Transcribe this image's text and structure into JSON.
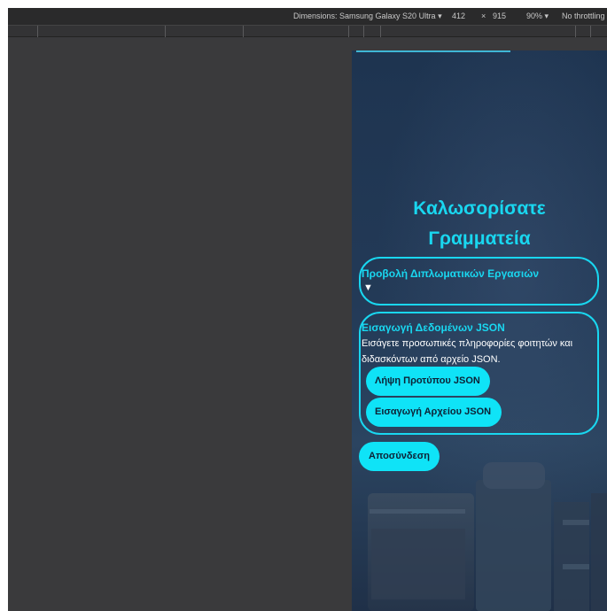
{
  "devtools": {
    "dimensions_label": "Dimensions: Samsung Galaxy S20 Ultra ▾",
    "width": "412",
    "times": "×",
    "height": "915",
    "zoom": "90% ▾",
    "throttling": "No throttling"
  },
  "app": {
    "welcome_line1": "Καλωσορίσατε",
    "welcome_line2": "Γραμματεία",
    "theses": {
      "title": "Προβολή Διπλωματικών Εργασιών",
      "toggle": "▼"
    },
    "import": {
      "title": "Εισαγωγή Δεδομένων JSON",
      "description": "Εισάγετε προσωπικές πληροφορίες φοιτητών και διδασκόντων από αρχείο JSON.",
      "template_button": "Λήψη Προτύπου JSON",
      "import_button": "Εισαγωγή Αρχείου JSON"
    },
    "logout_button": "Αποσύνδεση"
  },
  "colors": {
    "accent": "#19d7f0",
    "button_bg": "#0fe3f7",
    "background": "#233a57"
  }
}
